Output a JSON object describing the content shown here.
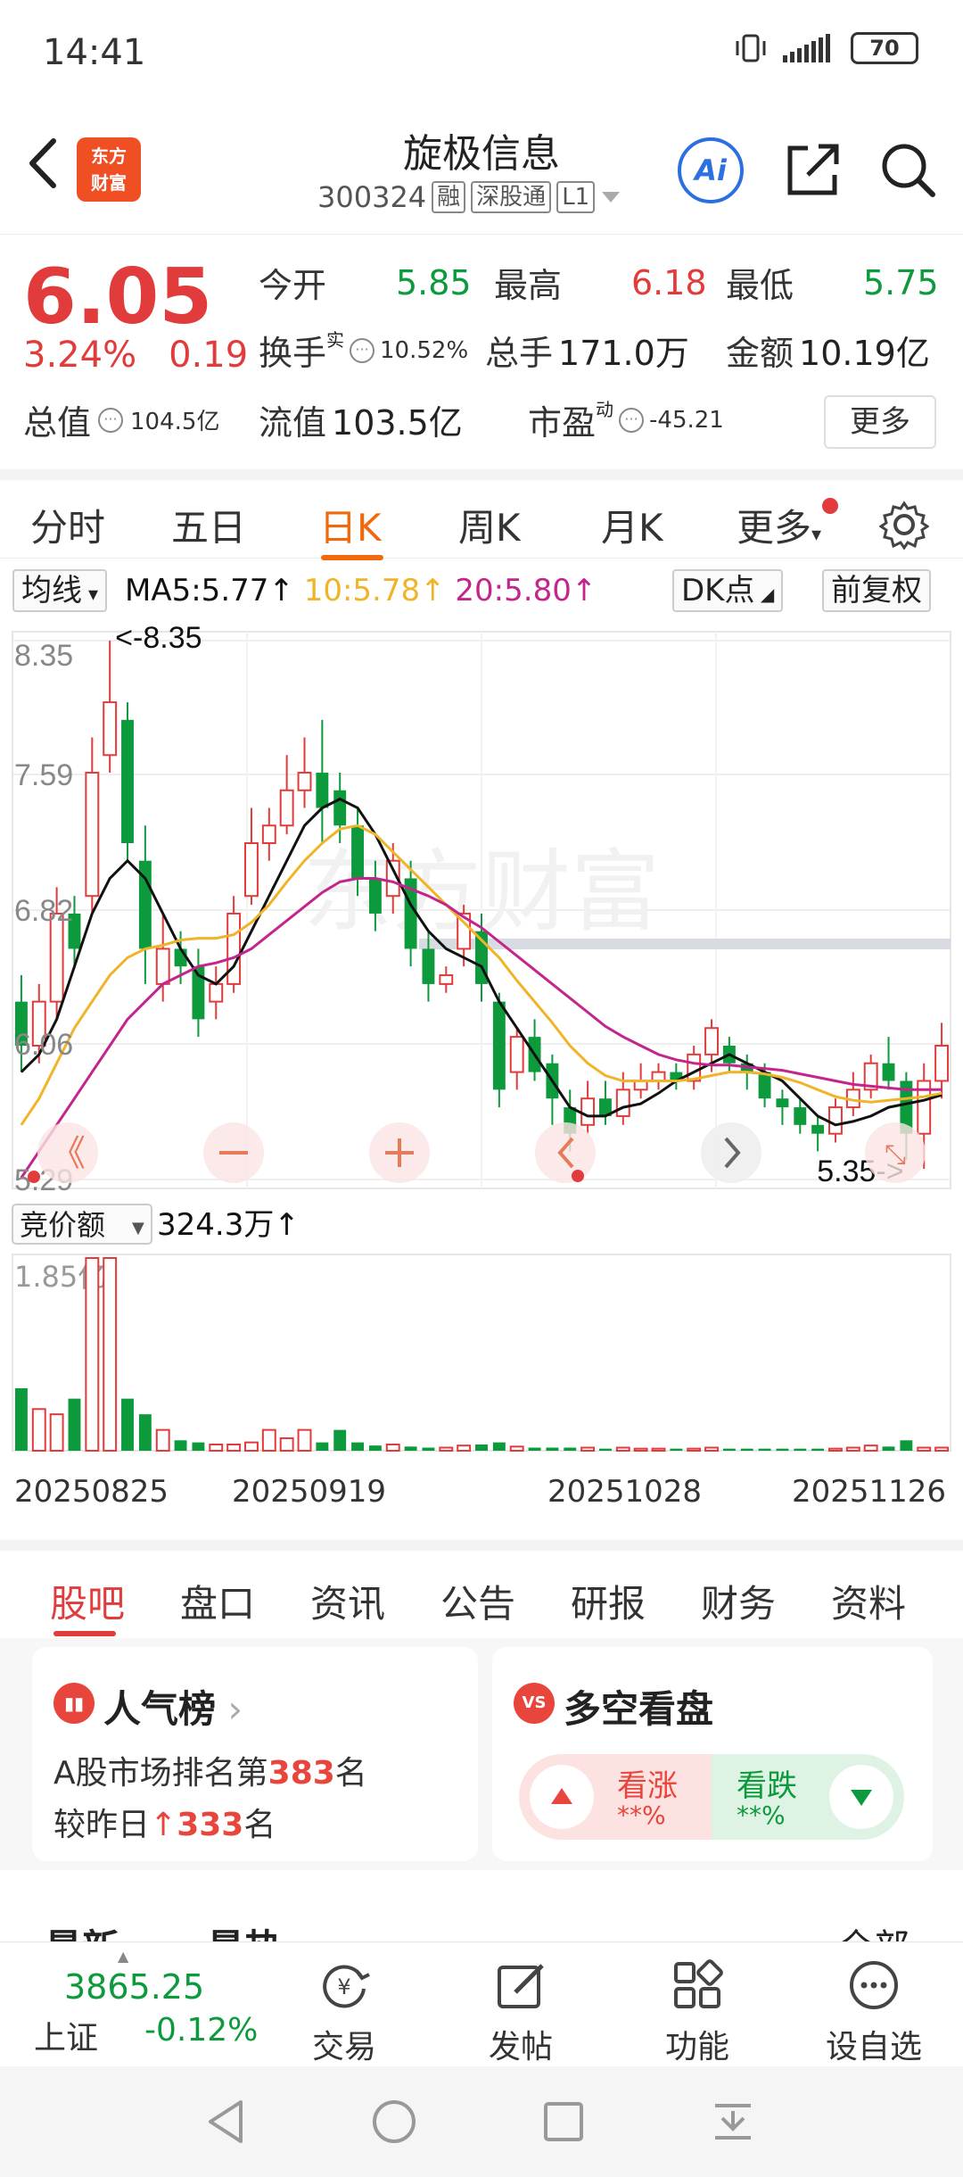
{
  "status_bar": {
    "time": "14:41",
    "battery": "70"
  },
  "header": {
    "logo_line1": "东方",
    "logo_line2": "财富",
    "stock_name": "旋极信息",
    "stock_code": "300324",
    "tags": [
      "融",
      "深股通",
      "L1"
    ],
    "ai_label": "Ai"
  },
  "quote": {
    "price": "6.05",
    "change_pct": "3.24%",
    "change_amt": "0.19",
    "open_label": "今开",
    "open": "5.85",
    "high_label": "最高",
    "high": "6.18",
    "low_label": "最低",
    "low": "5.75",
    "turnover_label": "换手",
    "turnover_sup": "实",
    "turnover": "10.52%",
    "volume_label": "总手",
    "volume": "171.0万",
    "amount_label": "金额",
    "amount": "10.19亿",
    "total_cap_label": "总值",
    "total_cap": "104.5亿",
    "float_cap_label": "流值",
    "float_cap": "103.5亿",
    "pe_label": "市盈",
    "pe_sup": "动",
    "pe": "-45.21",
    "more": "更多"
  },
  "period_tabs": [
    "分时",
    "五日",
    "日K",
    "周K",
    "月K",
    "更多"
  ],
  "ma_bar": {
    "dropdown": "均线",
    "ma5": "MA5:5.77↑",
    "ma10": "10:5.78↑",
    "ma20": "20:5.80↑",
    "dk": "DK点",
    "adjust": "前复权"
  },
  "colors": {
    "up": "#e23b3b",
    "down": "#0c9a3c",
    "ma5": "#111111",
    "ma10": "#f0b429",
    "ma20": "#c4258c",
    "accent_orange": "#f06a0d"
  },
  "chart_data": {
    "type": "candlestick",
    "y_ticks": [
      "8.35",
      "7.59",
      "6.82",
      "6.06",
      "5.29"
    ],
    "ylim": [
      5.29,
      8.35
    ],
    "max_label": "<-8.35",
    "min_label": "5.35->",
    "volume_indicator": "竞价额",
    "volume_value": "324.3万↑",
    "volume_max_label": "1.85亿",
    "x_dates": [
      "20250825",
      "20250919",
      "20251028",
      "20251126"
    ],
    "candles": [
      [
        6.3,
        6.05,
        6.45,
        5.9
      ],
      [
        6.05,
        6.3,
        6.4,
        5.95
      ],
      [
        6.3,
        6.8,
        6.95,
        6.2
      ],
      [
        6.8,
        6.6,
        6.9,
        6.5
      ],
      [
        6.9,
        7.6,
        7.8,
        6.8
      ],
      [
        7.7,
        8.0,
        8.35,
        7.6
      ],
      [
        7.9,
        7.2,
        8.0,
        7.1
      ],
      [
        7.1,
        6.6,
        7.3,
        6.4
      ],
      [
        6.4,
        6.6,
        6.8,
        6.3
      ],
      [
        6.6,
        6.5,
        6.7,
        6.4
      ],
      [
        6.5,
        6.2,
        6.6,
        6.1
      ],
      [
        6.3,
        6.4,
        6.5,
        6.2
      ],
      [
        6.4,
        6.8,
        6.9,
        6.35
      ],
      [
        6.9,
        7.2,
        7.4,
        6.85
      ],
      [
        7.2,
        7.3,
        7.4,
        7.1
      ],
      [
        7.3,
        7.5,
        7.7,
        7.25
      ],
      [
        7.5,
        7.6,
        7.8,
        7.4
      ],
      [
        7.6,
        7.4,
        7.9,
        7.2
      ],
      [
        7.5,
        7.3,
        7.6,
        7.2
      ],
      [
        7.3,
        7.0,
        7.4,
        6.9
      ],
      [
        7.0,
        6.8,
        7.1,
        6.7
      ],
      [
        6.9,
        7.1,
        7.2,
        6.8
      ],
      [
        7.0,
        6.6,
        7.1,
        6.5
      ],
      [
        6.6,
        6.4,
        6.7,
        6.3
      ],
      [
        6.4,
        6.45,
        6.5,
        6.35
      ],
      [
        6.6,
        6.8,
        6.85,
        6.5
      ],
      [
        6.7,
        6.4,
        6.8,
        6.3
      ],
      [
        6.3,
        5.8,
        6.35,
        5.7
      ],
      [
        5.9,
        6.1,
        6.15,
        5.8
      ],
      [
        6.1,
        5.9,
        6.2,
        5.85
      ],
      [
        5.95,
        5.75,
        6.0,
        5.6
      ],
      [
        5.7,
        5.55,
        5.8,
        5.45
      ],
      [
        5.6,
        5.75,
        5.85,
        5.55
      ],
      [
        5.75,
        5.65,
        5.85,
        5.6
      ],
      [
        5.65,
        5.8,
        5.9,
        5.6
      ],
      [
        5.8,
        5.85,
        5.95,
        5.75
      ],
      [
        5.85,
        5.9,
        5.95,
        5.8
      ],
      [
        5.9,
        5.85,
        5.95,
        5.8
      ],
      [
        5.85,
        6.0,
        6.05,
        5.8
      ],
      [
        6.0,
        6.15,
        6.2,
        5.9
      ],
      [
        6.05,
        5.95,
        6.1,
        5.9
      ],
      [
        5.95,
        5.9,
        6.0,
        5.8
      ],
      [
        5.9,
        5.75,
        5.95,
        5.7
      ],
      [
        5.75,
        5.7,
        5.8,
        5.6
      ],
      [
        5.7,
        5.6,
        5.75,
        5.55
      ],
      [
        5.6,
        5.55,
        5.65,
        5.45
      ],
      [
        5.55,
        5.7,
        5.75,
        5.5
      ],
      [
        5.7,
        5.8,
        5.9,
        5.65
      ],
      [
        5.8,
        5.95,
        6.0,
        5.75
      ],
      [
        5.95,
        5.85,
        6.1,
        5.8
      ],
      [
        5.85,
        5.55,
        5.9,
        5.4
      ],
      [
        5.55,
        5.85,
        5.95,
        5.35
      ],
      [
        5.85,
        6.05,
        6.18,
        5.75
      ]
    ],
    "ma5": [
      5.9,
      6.0,
      6.2,
      6.5,
      6.8,
      7.0,
      7.1,
      7.0,
      6.8,
      6.6,
      6.45,
      6.4,
      6.5,
      6.7,
      6.9,
      7.1,
      7.3,
      7.4,
      7.45,
      7.4,
      7.25,
      7.05,
      6.85,
      6.7,
      6.6,
      6.55,
      6.5,
      6.3,
      6.15,
      6.0,
      5.85,
      5.7,
      5.65,
      5.65,
      5.7,
      5.72,
      5.78,
      5.85,
      5.9,
      5.95,
      6.0,
      5.95,
      5.9,
      5.85,
      5.75,
      5.65,
      5.6,
      5.62,
      5.65,
      5.7,
      5.72,
      5.74,
      5.77
    ],
    "ma10": [
      5.6,
      5.75,
      5.95,
      6.15,
      6.3,
      6.45,
      6.55,
      6.6,
      6.62,
      6.65,
      6.66,
      6.66,
      6.68,
      6.75,
      6.85,
      6.98,
      7.1,
      7.2,
      7.28,
      7.3,
      7.25,
      7.15,
      7.05,
      6.95,
      6.85,
      6.75,
      6.65,
      6.55,
      6.42,
      6.3,
      6.18,
      6.05,
      5.95,
      5.88,
      5.85,
      5.85,
      5.85,
      5.85,
      5.86,
      5.88,
      5.9,
      5.9,
      5.89,
      5.87,
      5.84,
      5.8,
      5.76,
      5.74,
      5.73,
      5.74,
      5.75,
      5.76,
      5.78
    ],
    "ma20": [
      5.3,
      5.45,
      5.6,
      5.75,
      5.9,
      6.05,
      6.2,
      6.3,
      6.4,
      6.45,
      6.5,
      6.52,
      6.55,
      6.6,
      6.68,
      6.76,
      6.84,
      6.92,
      6.98,
      7.0,
      7.0,
      6.98,
      6.94,
      6.9,
      6.85,
      6.78,
      6.72,
      6.64,
      6.56,
      6.48,
      6.4,
      6.32,
      6.24,
      6.16,
      6.1,
      6.05,
      6.0,
      5.97,
      5.95,
      5.94,
      5.94,
      5.93,
      5.92,
      5.91,
      5.89,
      5.87,
      5.85,
      5.83,
      5.82,
      5.81,
      5.8,
      5.8,
      5.8
    ],
    "volume": [
      0.6,
      0.4,
      0.35,
      0.5,
      1.85,
      1.85,
      0.5,
      0.35,
      0.2,
      0.1,
      0.08,
      0.06,
      0.06,
      0.08,
      0.2,
      0.12,
      0.2,
      0.08,
      0.2,
      0.08,
      0.05,
      0.06,
      0.04,
      0.03,
      0.03,
      0.05,
      0.06,
      0.08,
      0.04,
      0.03,
      0.03,
      0.03,
      0.03,
      0.02,
      0.03,
      0.02,
      0.02,
      0.02,
      0.02,
      0.03,
      0.02,
      0.02,
      0.02,
      0.02,
      0.02,
      0.02,
      0.02,
      0.03,
      0.05,
      0.04,
      0.1,
      0.03,
      0.03
    ]
  },
  "content_tabs": [
    "股吧",
    "盘口",
    "资讯",
    "公告",
    "研报",
    "财务",
    "资料"
  ],
  "popularity_card": {
    "title": "人气榜",
    "line1_prefix": "A股市场排名第",
    "rank": "383",
    "line1_suffix": "名",
    "line2_prefix": "较昨日",
    "rank_change": "333",
    "line2_suffix": "名"
  },
  "bullbear_card": {
    "title": "多空看盘",
    "up_label": "看涨",
    "up_value": "**%",
    "down_label": "看跌",
    "down_value": "**%"
  },
  "partial_row": {
    "left1": "最新",
    "left2": "最热",
    "right": "全部"
  },
  "bottom_bar": {
    "index_value": "3865.25",
    "index_name": "上证",
    "index_change": "-0.12%",
    "items": [
      "交易",
      "发帖",
      "功能",
      "设自选"
    ]
  }
}
